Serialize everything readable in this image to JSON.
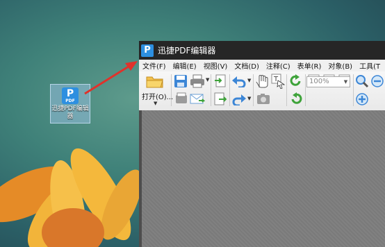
{
  "desktop": {
    "icon": {
      "badge": "PDF",
      "label": "迅捷PDF编辑器",
      "glyph": "P"
    }
  },
  "window": {
    "title": "迅捷PDF编辑器",
    "logo_glyph": "P"
  },
  "menu": [
    "文件(F)",
    "编辑(E)",
    "视图(V)",
    "文档(D)",
    "注释(C)",
    "表单(R)",
    "对象(B)",
    "工具(T"
  ],
  "toolbar": {
    "open_label": "打开(O)...",
    "zoom_value": "100%"
  },
  "colors": {
    "titlebar": "#262626",
    "accent": "#2d8fe0",
    "arrow": "#e0322b"
  }
}
